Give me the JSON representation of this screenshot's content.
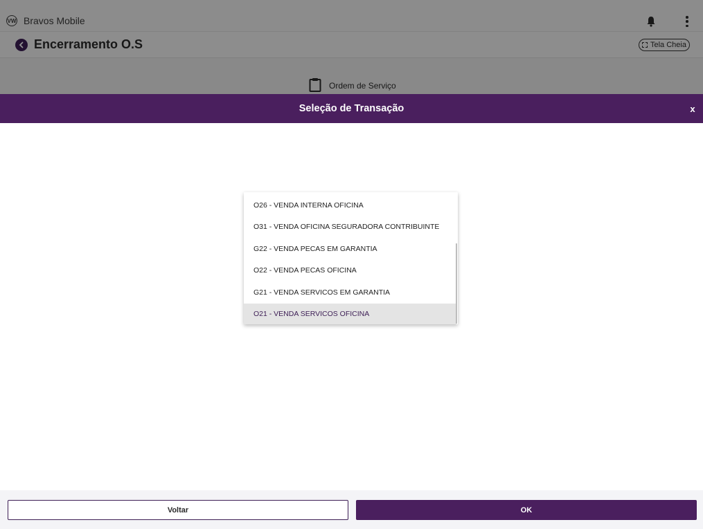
{
  "app": {
    "name": "Bravos Mobile",
    "logo_text": "VW"
  },
  "page": {
    "title": "Encerramento O.S",
    "fullscreen_label": "Tela Cheia",
    "section_title": "Ordem de Serviço"
  },
  "modal": {
    "title": "Seleção de Transação",
    "close_label": "x"
  },
  "transaction_options": [
    "O26 - VENDA INTERNA OFICINA",
    "O31 - VENDA OFICINA SEGURADORA CONTRIBUINTE",
    "G22 - VENDA PECAS EM GARANTIA",
    "O22 - VENDA PECAS OFICINA",
    "G21 - VENDA SERVICOS EM GARANTIA",
    "O21 - VENDA SERVICOS OFICINA"
  ],
  "selected_option": "O21 - VENDA SERVICOS OFICINA",
  "footer": {
    "back_label": "Voltar",
    "ok_label": "OK"
  },
  "colors": {
    "primary": "#4a1f5e",
    "selected_bg": "#e4e4e4"
  }
}
